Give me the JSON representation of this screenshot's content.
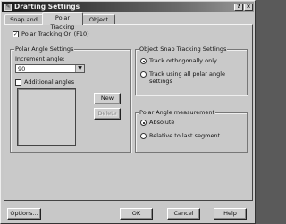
{
  "window": {
    "title": "Drafting Settings"
  },
  "tabs": [
    {
      "label": "Snap and Grid"
    },
    {
      "label": "Polar Tracking"
    },
    {
      "label": "Object Snap"
    }
  ],
  "polar_tracking": {
    "enable_label": "Polar Tracking On (F10)",
    "enabled": true,
    "angle_settings": {
      "group_label": "Polar Angle Settings",
      "increment_label": "Increment angle:",
      "increment_value": "90",
      "additional_label": "Additional angles",
      "additional_checked": false,
      "new_button": "New",
      "delete_button": "Delete"
    },
    "object_snap_tracking": {
      "group_label": "Object Snap Tracking Settings",
      "options": [
        {
          "label": "Track orthogonally only",
          "selected": true
        },
        {
          "label": "Track using all polar angle settings",
          "selected": false
        }
      ]
    },
    "angle_measurement": {
      "group_label": "Polar Angle measurement",
      "options": [
        {
          "label": "Absolute",
          "selected": true
        },
        {
          "label": "Relative to last segment",
          "selected": false
        }
      ]
    }
  },
  "footer": {
    "options_button": "Options...",
    "ok_button": "OK",
    "cancel_button": "Cancel",
    "help_button": "Help"
  }
}
